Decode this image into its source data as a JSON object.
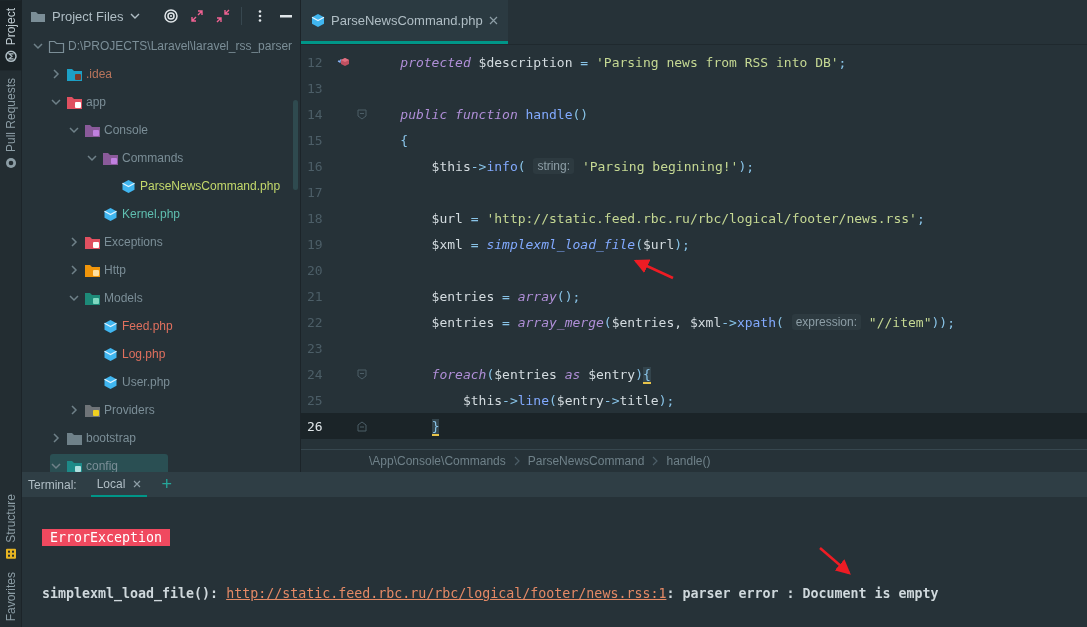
{
  "side_strip": {
    "top": [
      {
        "label": "Project",
        "selected": true
      },
      {
        "label": "Pull Requests",
        "selected": false
      }
    ],
    "bottom": [
      {
        "label": "Structure",
        "selected": false
      },
      {
        "label": "Favorites",
        "selected": false
      }
    ]
  },
  "project_panel": {
    "title": "Project Files",
    "tree": [
      {
        "label": "D:\\PROJECTS\\Laravel\\laravel_rss_parser",
        "kind": "root",
        "expanded": true,
        "selected": false,
        "color": "#7b8e97",
        "children": [
          {
            "label": ".idea",
            "kind": "idea",
            "expanded": false,
            "selected": false,
            "color": "#b9755c"
          },
          {
            "label": "app",
            "kind": "app",
            "expanded": true,
            "selected": false,
            "color": "#7b8e97",
            "children": [
              {
                "label": "Console",
                "kind": "console",
                "expanded": true,
                "selected": false,
                "color": "#7b8e97",
                "children": [
                  {
                    "label": "Commands",
                    "kind": "console",
                    "expanded": true,
                    "selected": false,
                    "color": "#7b8e97",
                    "children": [
                      {
                        "label": "ParseNewsCommand.php",
                        "kind": "php",
                        "selected": false,
                        "color": "#c3d86b"
                      }
                    ]
                  },
                  {
                    "label": "Kernel.php",
                    "kind": "php",
                    "selected": false,
                    "color": "#5fbfb0"
                  }
                ]
              },
              {
                "label": "Exceptions",
                "kind": "exceptions",
                "expanded": false,
                "selected": false,
                "color": "#7b8e97"
              },
              {
                "label": "Http",
                "kind": "http",
                "expanded": false,
                "selected": false,
                "color": "#7b8e97"
              },
              {
                "label": "Models",
                "kind": "models",
                "expanded": true,
                "selected": false,
                "color": "#7b8e97",
                "children": [
                  {
                    "label": "Feed.php",
                    "kind": "php",
                    "selected": false,
                    "color": "#e0705e"
                  },
                  {
                    "label": "Log.php",
                    "kind": "php",
                    "selected": false,
                    "color": "#e0705e"
                  },
                  {
                    "label": "User.php",
                    "kind": "php",
                    "selected": false,
                    "color": "#7b8e97"
                  }
                ]
              },
              {
                "label": "Providers",
                "kind": "providers",
                "expanded": false,
                "selected": false,
                "color": "#7b8e97"
              }
            ]
          },
          {
            "label": "bootstrap",
            "kind": "folder",
            "expanded": false,
            "selected": false,
            "color": "#7b8e97"
          },
          {
            "label": "config",
            "kind": "config",
            "expanded": true,
            "selected": true,
            "color": "#7b8e97"
          }
        ]
      }
    ]
  },
  "editor": {
    "tabs": [
      {
        "label": "ParseNewsCommand.php",
        "selected": true
      }
    ],
    "lines": [
      {
        "number": "12",
        "kind": "override",
        "current": false,
        "tokens": [
          {
            "kind": "keyword",
            "text": "    protected"
          },
          {
            "kind": "var",
            "text": " $description "
          },
          {
            "kind": "op",
            "text": "="
          },
          {
            "kind": "str",
            "text": " 'Parsing news from RSS into DB'"
          },
          {
            "kind": "op",
            "text": ";"
          }
        ]
      },
      {
        "number": "13",
        "current": false
      },
      {
        "number": "14",
        "kind": "fold-start",
        "current": false,
        "tokens": [
          {
            "kind": "keyword",
            "text": "    public function"
          },
          {
            "kind": "fn",
            "text": " handle"
          },
          {
            "kind": "op",
            "text": "()"
          }
        ]
      },
      {
        "number": "15",
        "current": false,
        "tokens": [
          {
            "kind": "op",
            "text": "    {"
          }
        ]
      },
      {
        "number": "16",
        "current": false,
        "tokens": [
          {
            "kind": "var",
            "text": "        $this"
          },
          {
            "kind": "op",
            "text": "->"
          },
          {
            "kind": "fn",
            "text": "info"
          },
          {
            "kind": "op",
            "text": "( "
          },
          {
            "kind": "hint",
            "text": "string:"
          },
          {
            "kind": "str",
            "text": " 'Parsing beginning!'"
          },
          {
            "kind": "op",
            "text": ");"
          }
        ]
      },
      {
        "number": "17",
        "current": false
      },
      {
        "number": "18",
        "current": false,
        "tokens": [
          {
            "kind": "var",
            "text": "        $url "
          },
          {
            "kind": "op",
            "text": "="
          },
          {
            "kind": "str",
            "text": " 'http://static.feed.rbc.ru/rbc/logical/footer/news.rss'"
          },
          {
            "kind": "op",
            "text": ";"
          }
        ]
      },
      {
        "number": "19",
        "current": false,
        "tokens": [
          {
            "kind": "var",
            "text": "        $xml "
          },
          {
            "kind": "op",
            "text": "= "
          },
          {
            "kind": "fn-italic",
            "text": "simplexml_load_file"
          },
          {
            "kind": "op",
            "text": "("
          },
          {
            "kind": "var",
            "text": "$url"
          },
          {
            "kind": "op",
            "text": ");"
          }
        ]
      },
      {
        "number": "20",
        "current": false
      },
      {
        "number": "21",
        "current": false,
        "tokens": [
          {
            "kind": "var",
            "text": "        $entries "
          },
          {
            "kind": "op",
            "text": "= "
          },
          {
            "kind": "keyword",
            "text": "array"
          },
          {
            "kind": "op",
            "text": "();"
          }
        ]
      },
      {
        "number": "22",
        "current": false,
        "tokens": [
          {
            "kind": "var",
            "text": "        $entries "
          },
          {
            "kind": "op",
            "text": "= "
          },
          {
            "kind": "keyword",
            "text": "array_merge"
          },
          {
            "kind": "op",
            "text": "("
          },
          {
            "kind": "var",
            "text": "$entries, $xml"
          },
          {
            "kind": "op",
            "text": "->"
          },
          {
            "kind": "fn",
            "text": "xpath"
          },
          {
            "kind": "op",
            "text": "( "
          },
          {
            "kind": "hint",
            "text": "expression:"
          },
          {
            "kind": "str",
            "text": " \"//item\""
          },
          {
            "kind": "op",
            "text": "));"
          }
        ]
      },
      {
        "number": "23",
        "current": false
      },
      {
        "number": "24",
        "kind": "fold-start",
        "current": false,
        "tokens": [
          {
            "kind": "keyword",
            "text": "        foreach"
          },
          {
            "kind": "op",
            "text": "("
          },
          {
            "kind": "var",
            "text": "$entries "
          },
          {
            "kind": "keyword",
            "text": "as"
          },
          {
            "kind": "var",
            "text": " $entry"
          },
          {
            "kind": "op",
            "text": ")"
          },
          {
            "kind": "brace-match",
            "text": "{"
          }
        ]
      },
      {
        "number": "25",
        "current": false,
        "tokens": [
          {
            "kind": "var",
            "text": "            $this"
          },
          {
            "kind": "op",
            "text": "->"
          },
          {
            "kind": "fn",
            "text": "line"
          },
          {
            "kind": "op",
            "text": "("
          },
          {
            "kind": "var",
            "text": "$entry"
          },
          {
            "kind": "op",
            "text": "->"
          },
          {
            "kind": "var",
            "text": "title"
          },
          {
            "kind": "op",
            "text": ");"
          }
        ]
      },
      {
        "number": "26",
        "kind": "fold-end",
        "current": true,
        "tokens": [
          {
            "kind": "brace-match",
            "text": "        }"
          }
        ]
      }
    ],
    "breadcrumbs": [
      "\\App\\Console\\Commands",
      "ParseNewsCommand",
      "handle()"
    ]
  },
  "terminal": {
    "label": "Terminal:",
    "tabs": [
      {
        "label": "Local",
        "selected": true
      }
    ],
    "add": "+",
    "output": [
      {
        "kind": "badge",
        "text": "ErrorException"
      },
      {
        "kind": "message",
        "parts": [
          {
            "kind": "plain",
            "text": "simplexml_load_file(): "
          },
          {
            "kind": "link",
            "text": "http://static.feed.rbc.ru/rbc/logical/footer/news.rss:1"
          },
          {
            "kind": "plain",
            "text": ": parser error : Document is empty"
          }
        ]
      }
    ]
  }
}
